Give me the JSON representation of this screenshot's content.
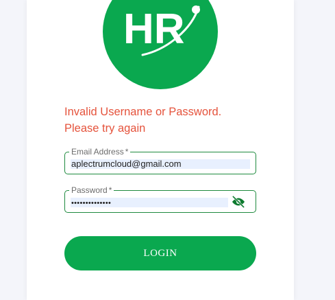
{
  "logo": {
    "text": "HR"
  },
  "error": {
    "line1": "Invalid Username or Password.",
    "line2": "Please try again"
  },
  "email": {
    "label": "Email Address",
    "required_mark": "*",
    "value": "aplectrumcloud@gmail.com"
  },
  "password": {
    "label": "Password",
    "required_mark": "*",
    "masked_value": "••••••••••••••",
    "toggle_icon": "eye-off-icon"
  },
  "login_button": {
    "label": "LOGIN"
  },
  "colors": {
    "brand_green": "#0aa84f",
    "field_border": "#1e8a3e",
    "error_red": "#e5533c",
    "autofill_bg": "#e8f0fe"
  }
}
